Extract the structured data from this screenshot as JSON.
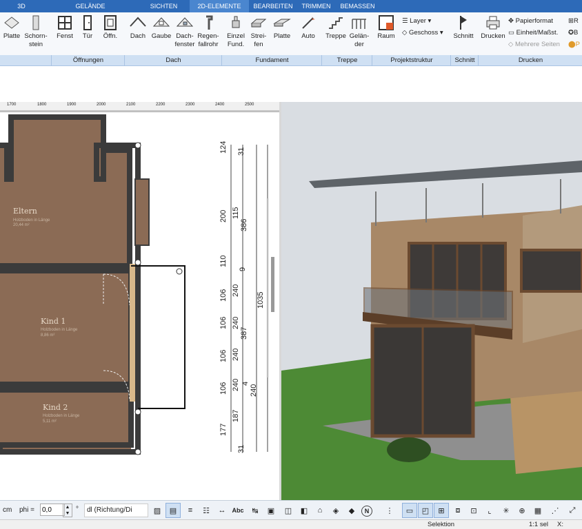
{
  "tabs": [
    "3D",
    "GELÄNDE",
    "SICHTEN",
    "2D-ELEMENTE",
    "BEARBEITEN",
    "TRIMMEN",
    "BEMASSEN"
  ],
  "ribbon": {
    "buttons": [
      "Platte",
      "Schorn-\nstein",
      "Fenst",
      "Tür",
      "Öffn.",
      "Dach",
      "Gaube",
      "Dach-\nfenster",
      "Regen-\nfallrohr",
      "Einzel\nFund.",
      "Strei-\nfen",
      "Platte",
      "Auto",
      "Treppe",
      "Gelän-\nder",
      "Raum",
      "Schnitt",
      "Drucken"
    ],
    "layer_label": "Layer",
    "geschoss_label": "Geschoss",
    "papierformat": "Papierformat",
    "einheit": "Einheit/Maßst.",
    "mehrere": "Mehrere Seiten",
    "groups": [
      "Öffnungen",
      "Dach",
      "Fundament",
      "Treppe",
      "Projektstruktur",
      "Schnitt",
      "Drucken"
    ]
  },
  "ruler_ticks": [
    "1700",
    "1800",
    "1900",
    "2000",
    "2100",
    "2200",
    "2300",
    "2400",
    "2500"
  ],
  "rooms": [
    {
      "name": "Eltern",
      "sub": "Holzboden in Länge",
      "area": "20,44 m²"
    },
    {
      "name": "Kind 1",
      "sub": "Holzboden in Länge",
      "area": "8,86 m²"
    },
    {
      "name": "Kind 2",
      "sub": "Holzboden in Länge",
      "area": "5,11 m²"
    }
  ],
  "dims": {
    "col1": [
      "124",
      "200",
      "110",
      "106",
      "106",
      "106",
      "106",
      "177"
    ],
    "col2": [
      "31",
      "115",
      "9",
      "240",
      "240",
      "240",
      "240",
      "187",
      "31"
    ],
    "col3": [
      "386",
      "387",
      "4",
      "240"
    ],
    "total": "1035"
  },
  "bottom": {
    "unit": "cm",
    "phi_label": "phi =",
    "phi_value": "0,0",
    "deg": "°",
    "dl_value": "dl (Richtung/Di",
    "abc": "Abc",
    "n_label": "N"
  },
  "status": {
    "mode": "Selektion",
    "scale": "1:1 sel",
    "x_label": "X:"
  },
  "colors": {
    "accent": "#2d6ab8",
    "floor": "#8a6a54",
    "wall": "#3b3b3b",
    "grass": "#4d8a35",
    "sky": "#d9dde2"
  }
}
